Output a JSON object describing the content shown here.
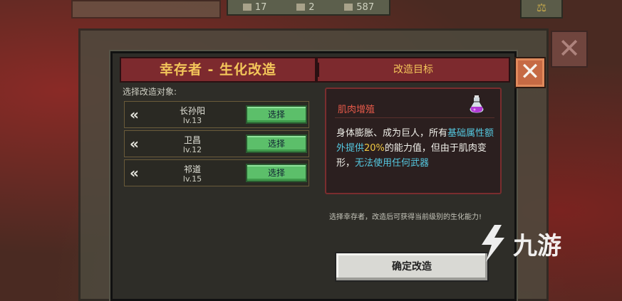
{
  "top_bar": {
    "resource_1": "17",
    "resource_2": "2",
    "resource_3": "587"
  },
  "panel": {
    "title": "幸存者 - 生化改造",
    "target_title": "改造目标",
    "select_label": "选择改造对象:",
    "survivors": [
      {
        "name": "长孙阳",
        "level": "lv.13",
        "button": "选择"
      },
      {
        "name": "卫昌",
        "level": "lv.12",
        "button": "选择"
      },
      {
        "name": "祁道",
        "level": "lv.15",
        "button": "选择"
      }
    ],
    "mod_card": {
      "name": "肌肉增殖",
      "desc_1": "身体膨胀、成为巨人，所有",
      "desc_hl_1": "基础属性额外提供",
      "desc_pct": "20%",
      "desc_2": "的能力值，但由于肌肉变形，",
      "desc_hl_2": "无法使用任何武器",
      "icon": "potion-icon"
    },
    "hint": "选择幸存者，改造后可获得当前级别的生化能力!",
    "confirm_label": "确定改造",
    "close_icon": "close-icon"
  },
  "watermark": "九游",
  "colors": {
    "title_bg": "#7d2a2e",
    "title_text": "#f3c65a",
    "select_button": "#5cbf6a",
    "highlight_cyan": "#55c8e0",
    "highlight_yellow": "#f0c843",
    "card_title": "#e75a4a",
    "close_button": "#c66a44"
  }
}
